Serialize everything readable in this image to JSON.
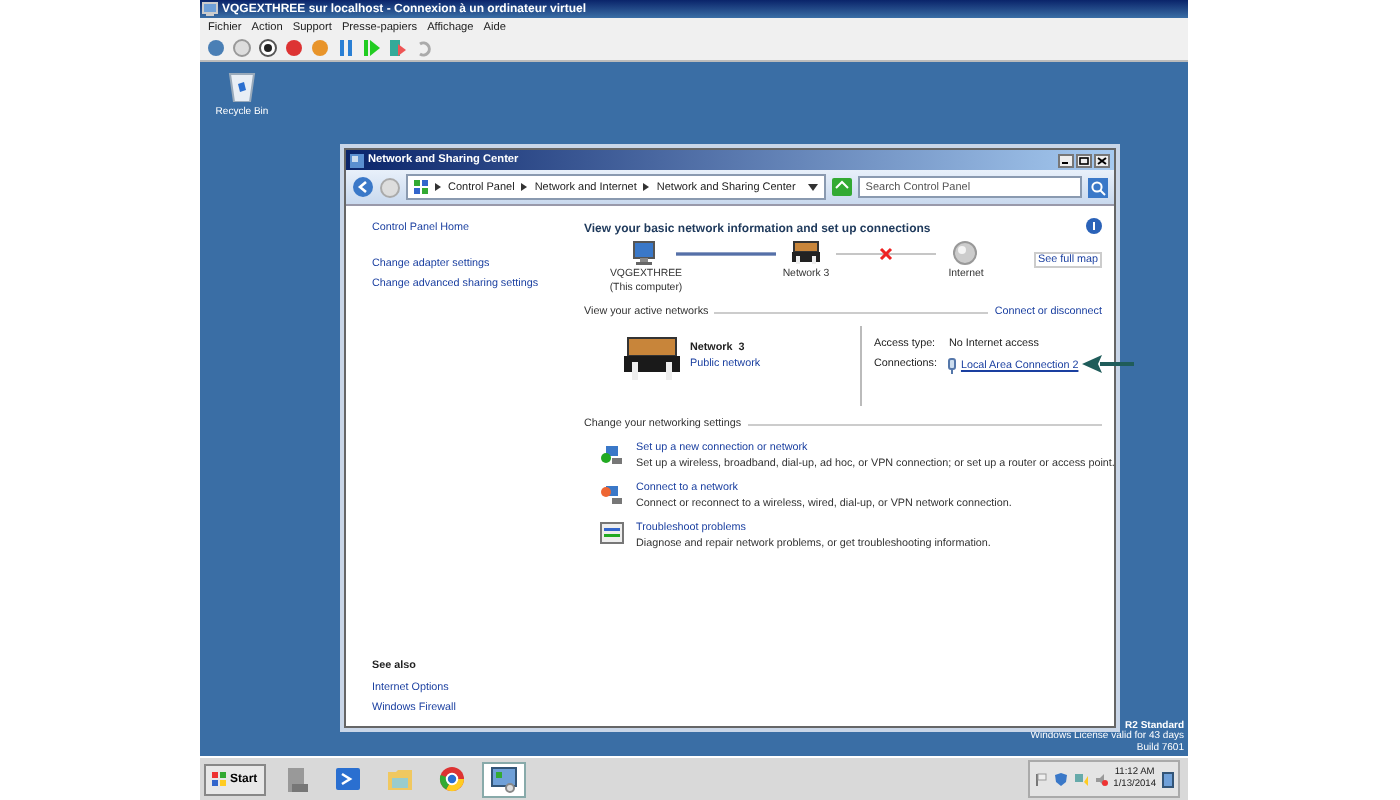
{
  "vm_window": {
    "title": "VQGEXTHREE sur localhost - Connexion à un ordinateur virtuel",
    "menu": [
      "Fichier",
      "Action",
      "Support",
      "Presse-papiers",
      "Affichage",
      "Aide"
    ]
  },
  "desktop": {
    "icons": [
      {
        "label": "Recycle Bin"
      }
    ],
    "license_lines": [
      "R2 Standard",
      "Windows License valid for 43 days",
      "Build 7601"
    ]
  },
  "window": {
    "title": "Network and Sharing Center",
    "breadcrumb": [
      "Control Panel",
      "Network and Internet",
      "Network and Sharing Center"
    ],
    "search": {
      "placeholder": "Search Control Panel"
    }
  },
  "sidebar": {
    "items": [
      "Control Panel Home",
      "Change adapter settings",
      "Change advanced sharing settings"
    ],
    "see_also_title": "See also",
    "see_also": [
      "Internet Options",
      "Windows Firewall"
    ]
  },
  "main": {
    "heading": "View your basic network information and set up connections",
    "see_full_map": "See full map",
    "map": [
      {
        "kind": "computer",
        "label": "VQGEXTHREE",
        "sublabel": "(This computer)"
      },
      {
        "kind": "network",
        "label": "Network  3",
        "broken_before": false
      },
      {
        "kind": "internet",
        "label": "Internet",
        "broken_before": true
      }
    ],
    "active_networks": {
      "title": "View your active networks",
      "action": "Connect or disconnect",
      "name": "Network  3",
      "type": "Public network",
      "access_type_label": "Access type:",
      "access_type": "No Internet access",
      "connections_label": "Connections:",
      "connection": "Local Area Connection 2"
    },
    "settings": {
      "title": "Change your networking settings",
      "items": [
        {
          "kind": "setup",
          "title": "Set up a new connection or network",
          "description": "Set up a wireless, broadband, dial-up, ad hoc, or VPN connection; or set up a router or access point."
        },
        {
          "kind": "connect",
          "title": "Connect to a network",
          "description": "Connect or reconnect to a wireless, wired, dial-up, or VPN network connection."
        },
        {
          "kind": "troubleshoot",
          "title": "Troubleshoot problems",
          "description": "Diagnose and repair network problems, or get troubleshooting information."
        }
      ]
    }
  },
  "taskbar": {
    "start": "Start",
    "apps": [
      {
        "kind": "server",
        "selected": false
      },
      {
        "kind": "powershell",
        "selected": false
      },
      {
        "kind": "folder",
        "selected": false
      },
      {
        "kind": "browser",
        "selected": false
      },
      {
        "kind": "control-panel",
        "selected": true
      }
    ],
    "time": "11:12 AM",
    "date": "1/13/2014"
  }
}
